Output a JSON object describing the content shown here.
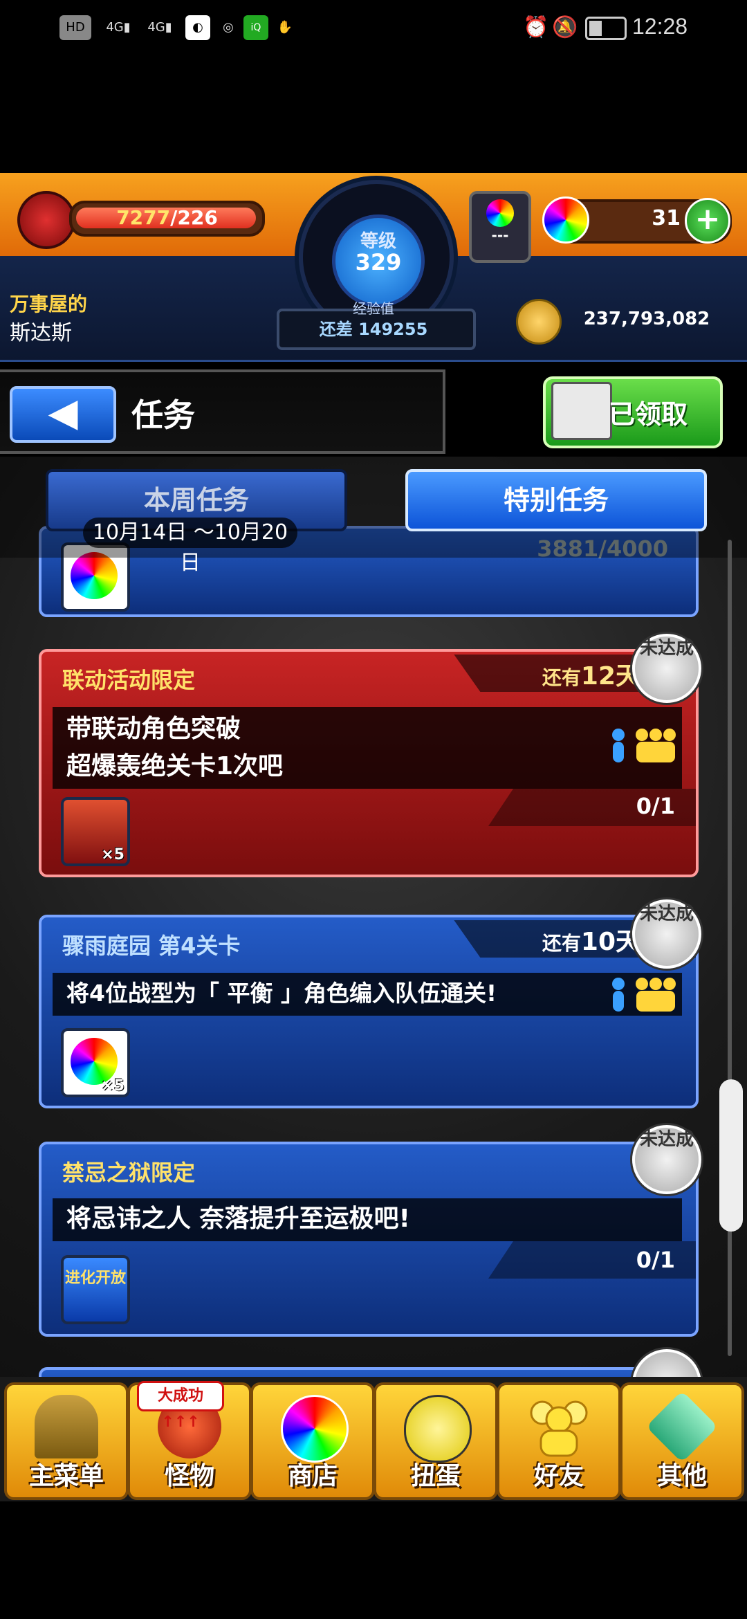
{
  "status_bar": {
    "time": "12:28",
    "left_icons": [
      "hd-icon",
      "signal-4g-icon",
      "signal-4g-icon",
      "app-icon",
      "wechat-icon",
      "iqiyi-icon",
      "hand-icon"
    ],
    "right_icons": [
      "alarm-icon",
      "mute-icon",
      "battery-icon"
    ]
  },
  "player": {
    "stamina": "7277",
    "stamina_max": "/226",
    "rank_label": "等级",
    "rank": "329",
    "exp_label": "经验值",
    "exp_remaining": "还差 149255",
    "title_line1": "万事屋的",
    "title_line2": "斯达斯",
    "orbs": "31",
    "lock_text": "---",
    "gold": "237,793,082"
  },
  "page": {
    "title": "任务",
    "claimed_label": "已领取"
  },
  "tabs": {
    "weekly": "本周任务",
    "special": "特别任务",
    "date_range": "10月14日 ～10月20日"
  },
  "missions": [
    {
      "progress": "3881/4000",
      "reward_type": "orb-icon",
      "reward_qty": ""
    },
    {
      "category": "联动活动限定",
      "days_prefix": "还有",
      "days": "12天",
      "line1": "带联动角色突破",
      "line2": "超爆轰绝关卡1次吧",
      "progress": "0/1",
      "stamp": "未达成",
      "reward_qty": "×5"
    },
    {
      "category": "骤雨庭园 第4关卡",
      "days_prefix": "还有",
      "days": "10天",
      "line1": "将4位战型为「 平衡 」角色编入队伍通关!",
      "progress": "",
      "stamp": "未达成",
      "reward_qty": "×5"
    },
    {
      "category": "禁忌之狱限定",
      "line1": "将忌讳之人 奈落提升至运极吧!",
      "progress": "0/1",
      "stamp": "未达成",
      "reward_text": "进化开放"
    }
  ],
  "nav": [
    {
      "label": "主菜单",
      "icon": "gate-icon"
    },
    {
      "label": "怪物",
      "icon": "dragon-icon",
      "badge": "大成功↑↑↑"
    },
    {
      "label": "商店",
      "icon": "orb-icon"
    },
    {
      "label": "扭蛋",
      "icon": "egg-icon"
    },
    {
      "label": "好友",
      "icon": "friends-icon"
    },
    {
      "label": "其他",
      "icon": "question-icon"
    }
  ],
  "colors": {
    "header_orange": "#f7a11e",
    "card_blue": "#245cc8",
    "card_red": "#c82424",
    "accent_yellow": "#ffe26a"
  }
}
